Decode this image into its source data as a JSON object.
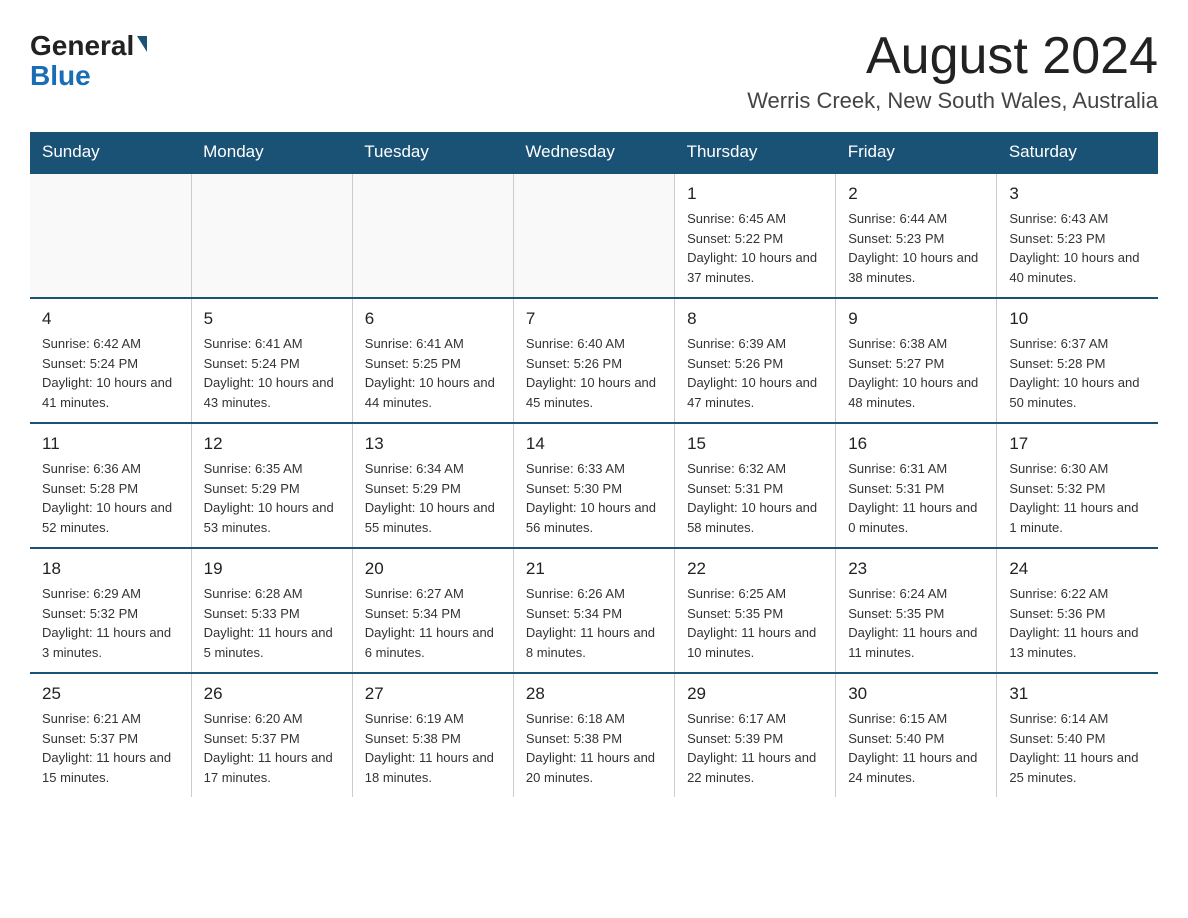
{
  "header": {
    "month_title": "August 2024",
    "location": "Werris Creek, New South Wales, Australia",
    "logo_general": "General",
    "logo_blue": "Blue"
  },
  "days_of_week": [
    "Sunday",
    "Monday",
    "Tuesday",
    "Wednesday",
    "Thursday",
    "Friday",
    "Saturday"
  ],
  "weeks": [
    [
      {
        "day": "",
        "info": ""
      },
      {
        "day": "",
        "info": ""
      },
      {
        "day": "",
        "info": ""
      },
      {
        "day": "",
        "info": ""
      },
      {
        "day": "1",
        "info": "Sunrise: 6:45 AM\nSunset: 5:22 PM\nDaylight: 10 hours and 37 minutes."
      },
      {
        "day": "2",
        "info": "Sunrise: 6:44 AM\nSunset: 5:23 PM\nDaylight: 10 hours and 38 minutes."
      },
      {
        "day": "3",
        "info": "Sunrise: 6:43 AM\nSunset: 5:23 PM\nDaylight: 10 hours and 40 minutes."
      }
    ],
    [
      {
        "day": "4",
        "info": "Sunrise: 6:42 AM\nSunset: 5:24 PM\nDaylight: 10 hours and 41 minutes."
      },
      {
        "day": "5",
        "info": "Sunrise: 6:41 AM\nSunset: 5:24 PM\nDaylight: 10 hours and 43 minutes."
      },
      {
        "day": "6",
        "info": "Sunrise: 6:41 AM\nSunset: 5:25 PM\nDaylight: 10 hours and 44 minutes."
      },
      {
        "day": "7",
        "info": "Sunrise: 6:40 AM\nSunset: 5:26 PM\nDaylight: 10 hours and 45 minutes."
      },
      {
        "day": "8",
        "info": "Sunrise: 6:39 AM\nSunset: 5:26 PM\nDaylight: 10 hours and 47 minutes."
      },
      {
        "day": "9",
        "info": "Sunrise: 6:38 AM\nSunset: 5:27 PM\nDaylight: 10 hours and 48 minutes."
      },
      {
        "day": "10",
        "info": "Sunrise: 6:37 AM\nSunset: 5:28 PM\nDaylight: 10 hours and 50 minutes."
      }
    ],
    [
      {
        "day": "11",
        "info": "Sunrise: 6:36 AM\nSunset: 5:28 PM\nDaylight: 10 hours and 52 minutes."
      },
      {
        "day": "12",
        "info": "Sunrise: 6:35 AM\nSunset: 5:29 PM\nDaylight: 10 hours and 53 minutes."
      },
      {
        "day": "13",
        "info": "Sunrise: 6:34 AM\nSunset: 5:29 PM\nDaylight: 10 hours and 55 minutes."
      },
      {
        "day": "14",
        "info": "Sunrise: 6:33 AM\nSunset: 5:30 PM\nDaylight: 10 hours and 56 minutes."
      },
      {
        "day": "15",
        "info": "Sunrise: 6:32 AM\nSunset: 5:31 PM\nDaylight: 10 hours and 58 minutes."
      },
      {
        "day": "16",
        "info": "Sunrise: 6:31 AM\nSunset: 5:31 PM\nDaylight: 11 hours and 0 minutes."
      },
      {
        "day": "17",
        "info": "Sunrise: 6:30 AM\nSunset: 5:32 PM\nDaylight: 11 hours and 1 minute."
      }
    ],
    [
      {
        "day": "18",
        "info": "Sunrise: 6:29 AM\nSunset: 5:32 PM\nDaylight: 11 hours and 3 minutes."
      },
      {
        "day": "19",
        "info": "Sunrise: 6:28 AM\nSunset: 5:33 PM\nDaylight: 11 hours and 5 minutes."
      },
      {
        "day": "20",
        "info": "Sunrise: 6:27 AM\nSunset: 5:34 PM\nDaylight: 11 hours and 6 minutes."
      },
      {
        "day": "21",
        "info": "Sunrise: 6:26 AM\nSunset: 5:34 PM\nDaylight: 11 hours and 8 minutes."
      },
      {
        "day": "22",
        "info": "Sunrise: 6:25 AM\nSunset: 5:35 PM\nDaylight: 11 hours and 10 minutes."
      },
      {
        "day": "23",
        "info": "Sunrise: 6:24 AM\nSunset: 5:35 PM\nDaylight: 11 hours and 11 minutes."
      },
      {
        "day": "24",
        "info": "Sunrise: 6:22 AM\nSunset: 5:36 PM\nDaylight: 11 hours and 13 minutes."
      }
    ],
    [
      {
        "day": "25",
        "info": "Sunrise: 6:21 AM\nSunset: 5:37 PM\nDaylight: 11 hours and 15 minutes."
      },
      {
        "day": "26",
        "info": "Sunrise: 6:20 AM\nSunset: 5:37 PM\nDaylight: 11 hours and 17 minutes."
      },
      {
        "day": "27",
        "info": "Sunrise: 6:19 AM\nSunset: 5:38 PM\nDaylight: 11 hours and 18 minutes."
      },
      {
        "day": "28",
        "info": "Sunrise: 6:18 AM\nSunset: 5:38 PM\nDaylight: 11 hours and 20 minutes."
      },
      {
        "day": "29",
        "info": "Sunrise: 6:17 AM\nSunset: 5:39 PM\nDaylight: 11 hours and 22 minutes."
      },
      {
        "day": "30",
        "info": "Sunrise: 6:15 AM\nSunset: 5:40 PM\nDaylight: 11 hours and 24 minutes."
      },
      {
        "day": "31",
        "info": "Sunrise: 6:14 AM\nSunset: 5:40 PM\nDaylight: 11 hours and 25 minutes."
      }
    ]
  ]
}
